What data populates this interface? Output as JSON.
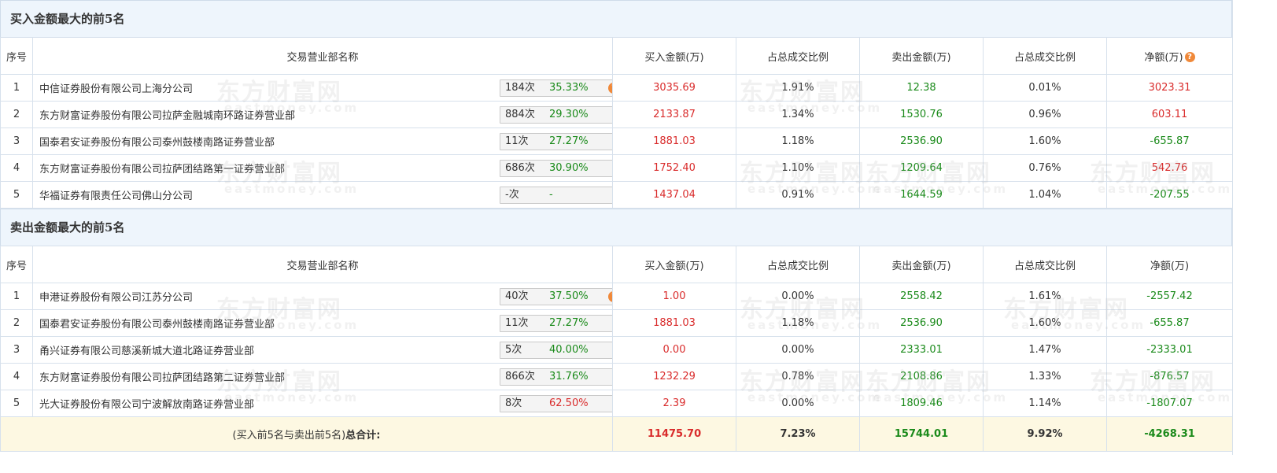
{
  "watermark": {
    "brand": "东方财富网",
    "domain": "eastmoney.com"
  },
  "buy_section": {
    "title": "买入金额最大的前5名",
    "headers": [
      "序号",
      "交易营业部名称",
      "买入金额(万)",
      "占总成交比例",
      "卖出金额(万)",
      "占总成交比例",
      "净额(万)"
    ],
    "rows": [
      {
        "idx": "1",
        "name": "中信证券股份有限公司上海分公司",
        "count": "184次",
        "pct": "35.33%",
        "pct_color": "green",
        "icon": "question-icon",
        "buy": "3035.69",
        "buy_ratio": "1.91%",
        "sell": "12.38",
        "sell_ratio": "0.01%",
        "net": "3023.31",
        "net_color": "red"
      },
      {
        "idx": "2",
        "name": "东方财富证券股份有限公司拉萨金融城南环路证券营业部",
        "count": "884次",
        "pct": "29.30%",
        "pct_color": "green",
        "icon": "play-arrow-icon",
        "buy": "2133.87",
        "buy_ratio": "1.34%",
        "sell": "1530.76",
        "sell_ratio": "0.96%",
        "net": "603.11",
        "net_color": "red"
      },
      {
        "idx": "3",
        "name": "国泰君安证券股份有限公司泰州鼓楼南路证券营业部",
        "count": "11次",
        "pct": "27.27%",
        "pct_color": "green",
        "icon": "play-arrow-icon",
        "buy": "1881.03",
        "buy_ratio": "1.18%",
        "sell": "2536.90",
        "sell_ratio": "1.60%",
        "net": "-655.87",
        "net_color": "green"
      },
      {
        "idx": "4",
        "name": "东方财富证券股份有限公司拉萨团结路第一证券营业部",
        "count": "686次",
        "pct": "30.90%",
        "pct_color": "green",
        "icon": "play-arrow-icon",
        "buy": "1752.40",
        "buy_ratio": "1.10%",
        "sell": "1209.64",
        "sell_ratio": "0.76%",
        "net": "542.76",
        "net_color": "red"
      },
      {
        "idx": "5",
        "name": "华福证券有限责任公司佛山分公司",
        "count": "-次",
        "pct": "-",
        "pct_color": "plain",
        "icon": "play-arrow-icon",
        "buy": "1437.04",
        "buy_ratio": "0.91%",
        "sell": "1644.59",
        "sell_ratio": "1.04%",
        "net": "-207.55",
        "net_color": "green"
      }
    ]
  },
  "sell_section": {
    "title": "卖出金额最大的前5名",
    "headers": [
      "序号",
      "交易营业部名称",
      "买入金额(万)",
      "占总成交比例",
      "卖出金额(万)",
      "占总成交比例",
      "净额(万)"
    ],
    "rows": [
      {
        "idx": "1",
        "name": "申港证券股份有限公司江苏分公司",
        "count": "40次",
        "pct": "37.50%",
        "pct_color": "green",
        "icon": "question-icon",
        "buy": "1.00",
        "buy_ratio": "0.00%",
        "sell": "2558.42",
        "sell_ratio": "1.61%",
        "net": "-2557.42",
        "net_color": "green"
      },
      {
        "idx": "2",
        "name": "国泰君安证券股份有限公司泰州鼓楼南路证券营业部",
        "count": "11次",
        "pct": "27.27%",
        "pct_color": "green",
        "icon": "play-arrow-icon",
        "buy": "1881.03",
        "buy_ratio": "1.18%",
        "sell": "2536.90",
        "sell_ratio": "1.60%",
        "net": "-655.87",
        "net_color": "green"
      },
      {
        "idx": "3",
        "name": "甬兴证券有限公司慈溪新城大道北路证券营业部",
        "count": "5次",
        "pct": "40.00%",
        "pct_color": "green",
        "icon": "play-arrow-icon",
        "buy": "0.00",
        "buy_ratio": "0.00%",
        "sell": "2333.01",
        "sell_ratio": "1.47%",
        "net": "-2333.01",
        "net_color": "green"
      },
      {
        "idx": "4",
        "name": "东方财富证券股份有限公司拉萨团结路第二证券营业部",
        "count": "866次",
        "pct": "31.76%",
        "pct_color": "green",
        "icon": "play-arrow-icon",
        "buy": "1232.29",
        "buy_ratio": "0.78%",
        "sell": "2108.86",
        "sell_ratio": "1.33%",
        "net": "-876.57",
        "net_color": "green"
      },
      {
        "idx": "5",
        "name": "光大证券股份有限公司宁波解放南路证券营业部",
        "count": "8次",
        "pct": "62.50%",
        "pct_color": "red",
        "icon": "play-arrow-icon",
        "buy": "2.39",
        "buy_ratio": "0.00%",
        "sell": "1809.46",
        "sell_ratio": "1.14%",
        "net": "-1807.07",
        "net_color": "green"
      }
    ]
  },
  "total": {
    "label_prefix": "(买入前5名与卖出前5名)",
    "label_bold": "总合计:",
    "buy": "11475.70",
    "buy_ratio": "7.23%",
    "sell": "15744.01",
    "sell_ratio": "9.92%",
    "net": "-4268.31"
  },
  "colors": {
    "red": "#d92b2b",
    "green": "#1a8a1a",
    "header_bg": "#eef5fc",
    "total_bg": "#fdf8e2",
    "icon_orange": "#f0893a",
    "arrow_blue": "#1f5d96"
  }
}
